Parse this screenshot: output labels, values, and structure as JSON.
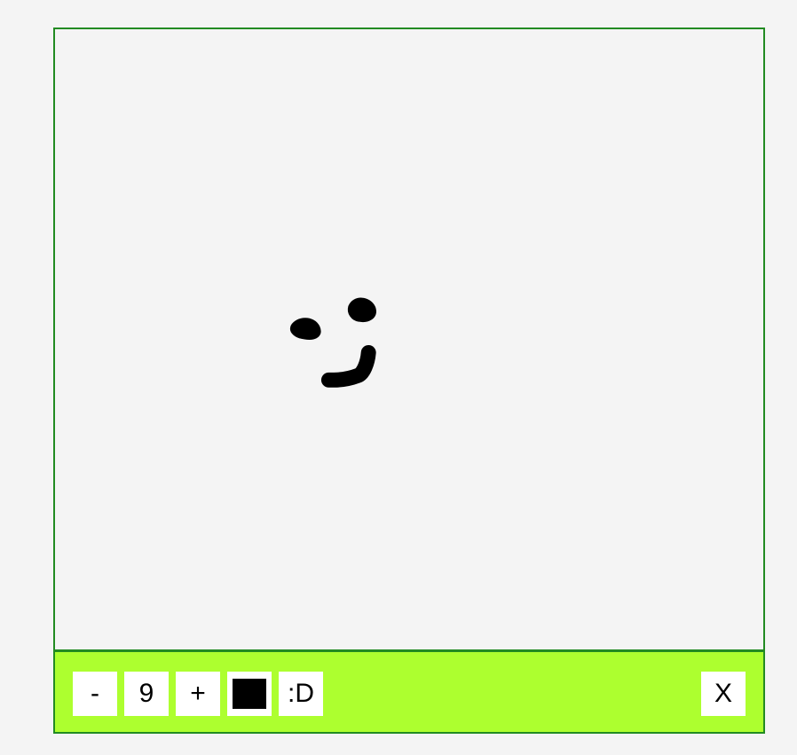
{
  "canvas": {
    "stroke_color": "#000000",
    "background_color": "#f4f4f4"
  },
  "toolbar": {
    "decrease_label": "-",
    "brush_size": "9",
    "increase_label": "+",
    "current_color": "#000000",
    "emoji_label": ":D",
    "close_label": "X",
    "background_color": "#adff2f"
  },
  "frame": {
    "border_color": "#228b22"
  }
}
